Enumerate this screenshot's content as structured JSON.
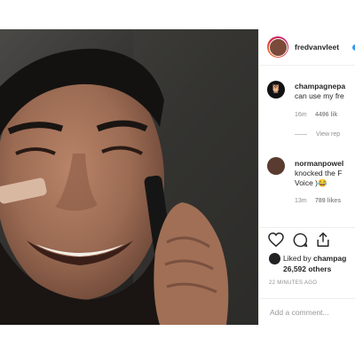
{
  "post": {
    "author": "fredvanvleet",
    "brand_colors": {
      "verified": "#3897f0",
      "text": "#262626",
      "muted": "#8e8e8e"
    }
  },
  "comments": [
    {
      "username": "champagnepa",
      "text_line1": "can use my fre",
      "time": "16m",
      "likes": "4496 lik",
      "view_replies": "View rep",
      "avatar_icon": "owl-icon"
    },
    {
      "username": "normanpowel",
      "text_line1": "knocked the F",
      "text_line2": "Voice )😂",
      "time": "13m",
      "likes": "789 likes"
    }
  ],
  "actions": {
    "icons": [
      "heart-icon",
      "comment-icon",
      "share-icon"
    ],
    "liked_by_prefix": "Liked by ",
    "liked_by_user": "champag",
    "likes_count": "26,592 others",
    "time_ago": "22 MINUTES AGO"
  },
  "add_comment": {
    "placeholder": "Add a comment..."
  }
}
